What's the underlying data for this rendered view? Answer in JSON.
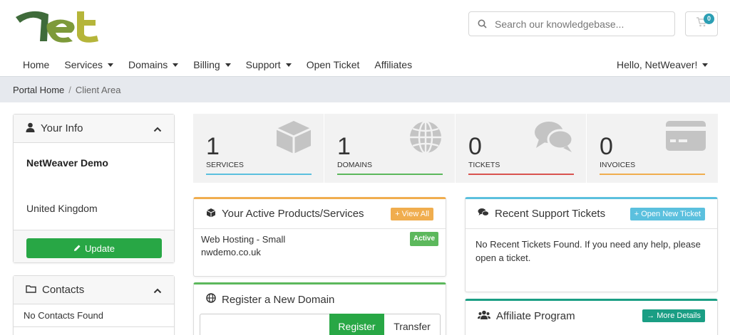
{
  "search": {
    "placeholder": "Search our knowledgebase..."
  },
  "cart": {
    "count": "0"
  },
  "nav": {
    "items": [
      {
        "label": "Home",
        "dropdown": false
      },
      {
        "label": "Services",
        "dropdown": true
      },
      {
        "label": "Domains",
        "dropdown": true
      },
      {
        "label": "Billing",
        "dropdown": true
      },
      {
        "label": "Support",
        "dropdown": true
      },
      {
        "label": "Open Ticket",
        "dropdown": false
      },
      {
        "label": "Affiliates",
        "dropdown": false
      }
    ],
    "user_greeting": "Hello, NetWeaver!"
  },
  "breadcrumb": {
    "home": "Portal Home",
    "separator": "/",
    "current": "Client Area"
  },
  "your_info": {
    "title": "Your Info",
    "name": "NetWeaver Demo",
    "country": "United Kingdom",
    "update_label": "Update"
  },
  "contacts": {
    "title": "Contacts",
    "empty": "No Contacts Found"
  },
  "stats": [
    {
      "value": "1",
      "label": "SERVICES",
      "color": "#5bc0de",
      "icon": "cube-icon"
    },
    {
      "value": "1",
      "label": "DOMAINS",
      "color": "#5cb85c",
      "icon": "globe-icon"
    },
    {
      "value": "0",
      "label": "TICKETS",
      "color": "#d9534f",
      "icon": "comments-icon"
    },
    {
      "value": "0",
      "label": "INVOICES",
      "color": "#f0ad4e",
      "icon": "credit-card-icon"
    }
  ],
  "products": {
    "title": "Your Active Products/Services",
    "view_all": "+ View All",
    "item_name": "Web Hosting - Small",
    "item_domain": "nwdemo.co.uk",
    "status": "Active"
  },
  "tickets": {
    "title": "Recent Support Tickets",
    "open_new": "+ Open New Ticket",
    "empty": "No Recent Tickets Found. If you need any help, please open a ticket."
  },
  "register_domain": {
    "title": "Register a New Domain",
    "register_label": "Register",
    "transfer_label": "Transfer"
  },
  "affiliate": {
    "title": "Affiliate Program",
    "details_label": "→ More Details"
  },
  "colors": {
    "primary_green": "#28a745",
    "accent_blue": "#5bc0de",
    "accent_orange": "#f0ad4e",
    "accent_teal": "#1a9e84"
  }
}
